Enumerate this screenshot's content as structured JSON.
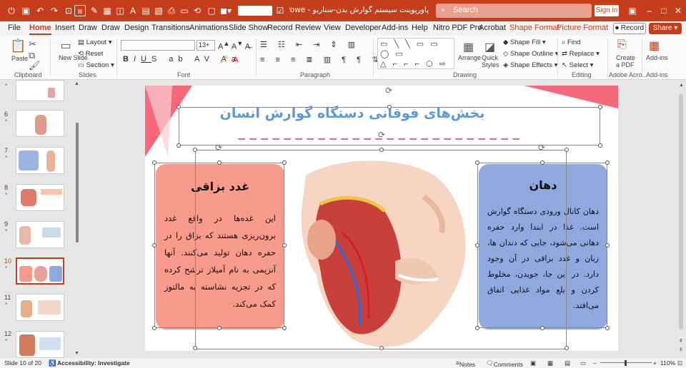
{
  "titlebar": {
    "doc_title": "پاورپوینت سیستم گوارش بدن-سناریو  -  Powe...",
    "search_placeholder": "Search",
    "signin_label": "Sign in",
    "font_name_value": "",
    "accent": "#c43e1c"
  },
  "menu": {
    "tabs": [
      "File",
      "Home",
      "Insert",
      "Draw",
      "Draw",
      "Design",
      "Transitions",
      "Animations",
      "Slide Show",
      "Record",
      "Review",
      "View",
      "Developer",
      "Add-ins",
      "Help",
      "Nitro PDF Pro",
      "Acrobat"
    ],
    "context_tabs": [
      "Shape Format",
      "Picture Format"
    ],
    "record_label": "Record",
    "share_label": "Share"
  },
  "ribbon": {
    "paste": "Paste",
    "new_slide": "New Slide",
    "layout": "Layout",
    "reset": "Reset",
    "section": "Section",
    "font_size": "13+",
    "arrange": "Arrange",
    "quick_styles": "Quick Styles",
    "shape_fill": "Shape Fill",
    "shape_outline": "Shape Outline",
    "shape_effects": "Shape Effects",
    "find": "Find",
    "replace": "Replace",
    "select": "Select",
    "create_pdf": "Create a PDF",
    "add_ins": "Add-ins",
    "groups": {
      "clipboard": "Clipboard",
      "slides": "Slides",
      "font": "Font",
      "paragraph": "Paragraph",
      "drawing": "Drawing",
      "editing": "Editing",
      "adobe": "Adobe Acro...",
      "addins": "Add-ins"
    }
  },
  "thumbnails": [
    {
      "num": "6",
      "star": "*"
    },
    {
      "num": "7",
      "star": "*"
    },
    {
      "num": "8",
      "star": "*"
    },
    {
      "num": "9",
      "star": "*"
    },
    {
      "num": "10",
      "star": "*"
    },
    {
      "num": "11",
      "star": "*"
    },
    {
      "num": "12",
      "star": "*"
    }
  ],
  "slide": {
    "title": "بخش‌های فوقانی دستگاه گوارش انسان",
    "left_heading": "غدد بزاقی",
    "left_body": "این غده‌ها در واقع غدد برون‌ریزی هستند که بزاق را در حفره دهان تولید می‌کنند. آنها آنزیمی به نام آمیلاز ترشح کرده که در تجزیه نشاسته به مالتوز کمک می‌کند.",
    "right_heading": "دهان",
    "right_body": "دهان کانال ورودی دستگاه گوارش است. غذا در ابتدا وارد حفره دهانی می‌شود، جایی که دندان ها، زبان و غدد بزاقی در آن وجود دارد. در این جا، جویدن، مخلوط کردن و بلع مواد غذایی اتفاق می‌افتد.",
    "colors": {
      "left_box": "#f89a8c",
      "right_box": "#8fa8dd",
      "title_text": "#5b9bd5",
      "corner": "#f6697a",
      "dash": "#e46c8c"
    }
  },
  "status": {
    "slide_info": "Slide 10 of 20",
    "accessibility": "Accessibility: Investigate",
    "notes": "Notes",
    "comments": "Comments",
    "zoom": "110%"
  }
}
